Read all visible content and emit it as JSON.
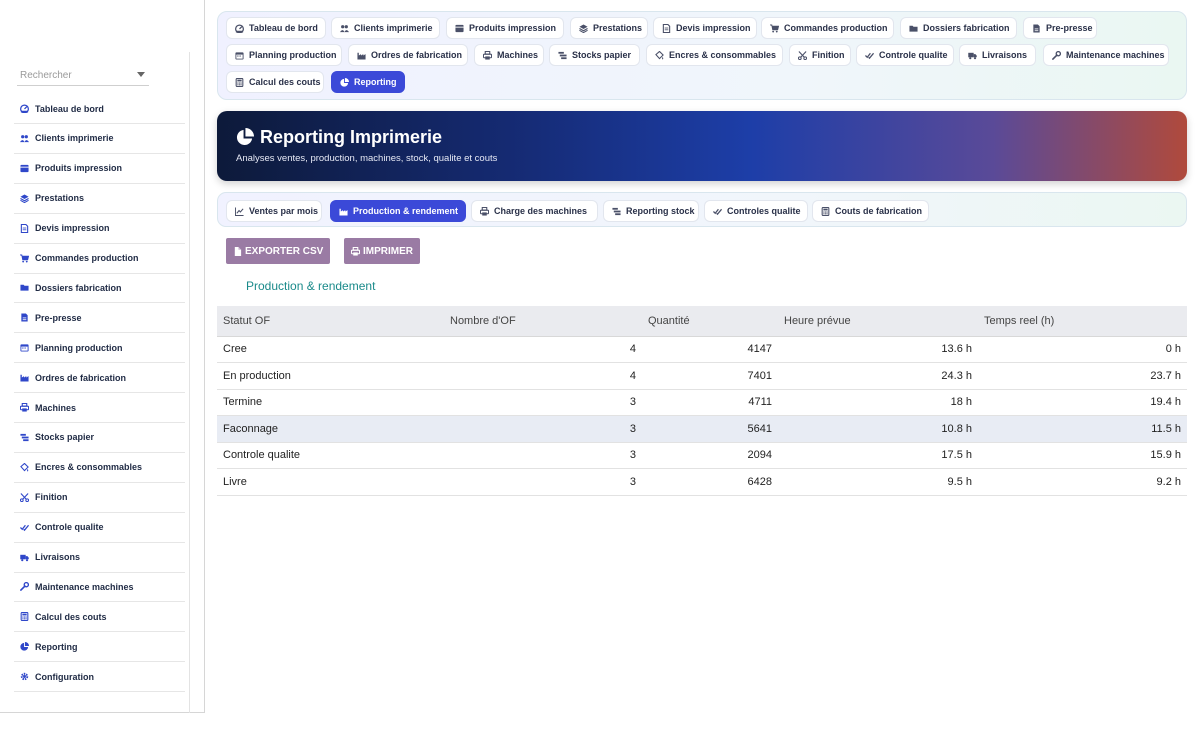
{
  "sidebar": {
    "search_placeholder": "Rechercher",
    "items": [
      {
        "label": "Tableau de bord",
        "icon": "gauge-icon"
      },
      {
        "label": "Clients imprimerie",
        "icon": "users-icon"
      },
      {
        "label": "Produits impression",
        "icon": "box-icon"
      },
      {
        "label": "Prestations",
        "icon": "layers-icon"
      },
      {
        "label": "Devis impression",
        "icon": "document-icon"
      },
      {
        "label": "Commandes production",
        "icon": "cart-icon"
      },
      {
        "label": "Dossiers fabrication",
        "icon": "folder-icon"
      },
      {
        "label": "Pre-presse",
        "icon": "file-icon"
      },
      {
        "label": "Planning production",
        "icon": "calendar-icon"
      },
      {
        "label": "Ordres de fabrication",
        "icon": "factory-icon"
      },
      {
        "label": "Machines",
        "icon": "printer-icon"
      },
      {
        "label": "Stocks papier",
        "icon": "paper-stack-icon"
      },
      {
        "label": "Encres & consommables",
        "icon": "paint-bucket-icon"
      },
      {
        "label": "Finition",
        "icon": "scissors-icon"
      },
      {
        "label": "Controle qualite",
        "icon": "check-double-icon"
      },
      {
        "label": "Livraisons",
        "icon": "truck-icon"
      },
      {
        "label": "Maintenance machines",
        "icon": "wrench-icon"
      },
      {
        "label": "Calcul des couts",
        "icon": "calculator-icon"
      },
      {
        "label": "Reporting",
        "icon": "pie-chart-icon"
      },
      {
        "label": "Configuration",
        "icon": "gear-icon"
      }
    ]
  },
  "topnav": {
    "items": [
      {
        "label": "Tableau de bord",
        "icon": "gauge-icon"
      },
      {
        "label": "Clients imprimerie",
        "icon": "users-icon"
      },
      {
        "label": "Produits impression",
        "icon": "box-icon"
      },
      {
        "label": "Prestations",
        "icon": "layers-icon"
      },
      {
        "label": "Devis impression",
        "icon": "document-icon"
      },
      {
        "label": "Commandes production",
        "icon": "cart-icon"
      },
      {
        "label": "Dossiers fabrication",
        "icon": "folder-icon"
      },
      {
        "label": "Pre-presse",
        "icon": "file-icon"
      },
      {
        "label": "Planning production",
        "icon": "calendar-icon"
      },
      {
        "label": "Ordres de fabrication",
        "icon": "factory-icon"
      },
      {
        "label": "Machines",
        "icon": "printer-icon"
      },
      {
        "label": "Stocks papier",
        "icon": "paper-stack-icon"
      },
      {
        "label": "Encres & consommables",
        "icon": "paint-bucket-icon"
      },
      {
        "label": "Finition",
        "icon": "scissors-icon"
      },
      {
        "label": "Controle qualite",
        "icon": "check-double-icon"
      },
      {
        "label": "Livraisons",
        "icon": "truck-icon"
      },
      {
        "label": "Maintenance machines",
        "icon": "wrench-icon"
      },
      {
        "label": "Calcul des couts",
        "icon": "calculator-icon"
      },
      {
        "label": "Reporting",
        "icon": "pie-chart-icon",
        "active": true
      }
    ]
  },
  "hero": {
    "title": "Reporting Imprimerie",
    "subtitle": "Analyses ventes, production, machines, stock, qualite et couts",
    "icon": "pie-chart-icon"
  },
  "subtabs": [
    {
      "label": "Ventes par mois",
      "icon": "line-chart-icon"
    },
    {
      "label": "Production & rendement",
      "icon": "factory-icon",
      "active": true
    },
    {
      "label": "Charge des machines",
      "icon": "printer-icon"
    },
    {
      "label": "Reporting stock",
      "icon": "paper-stack-icon"
    },
    {
      "label": "Controles qualite",
      "icon": "check-double-icon"
    },
    {
      "label": "Couts de fabrication",
      "icon": "calculator-icon"
    }
  ],
  "actions": {
    "export_label": "EXPORTER CSV",
    "print_label": "IMPRIMER"
  },
  "report": {
    "title": "Production & rendement",
    "columns": [
      "Statut OF",
      "Nombre d'OF",
      "Quantité",
      "Heure prévue",
      "Temps reel (h)"
    ],
    "rows": [
      [
        "Cree",
        "4",
        "4147",
        "13.6 h",
        "0 h"
      ],
      [
        "En production",
        "4",
        "7401",
        "24.3 h",
        "23.7 h"
      ],
      [
        "Termine",
        "3",
        "4711",
        "18 h",
        "19.4 h"
      ],
      [
        "Faconnage",
        "3",
        "5641",
        "10.8 h",
        "11.5 h"
      ],
      [
        "Controle qualite",
        "3",
        "2094",
        "17.5 h",
        "15.9 h"
      ],
      [
        "Livre",
        "3",
        "6428",
        "9.5 h",
        "9.2 h"
      ]
    ]
  },
  "colors": {
    "accent": "#3b49d8",
    "icon_blue": "#2f47c9",
    "button": "#9a7ba4",
    "section_title": "#1a8a8a"
  }
}
